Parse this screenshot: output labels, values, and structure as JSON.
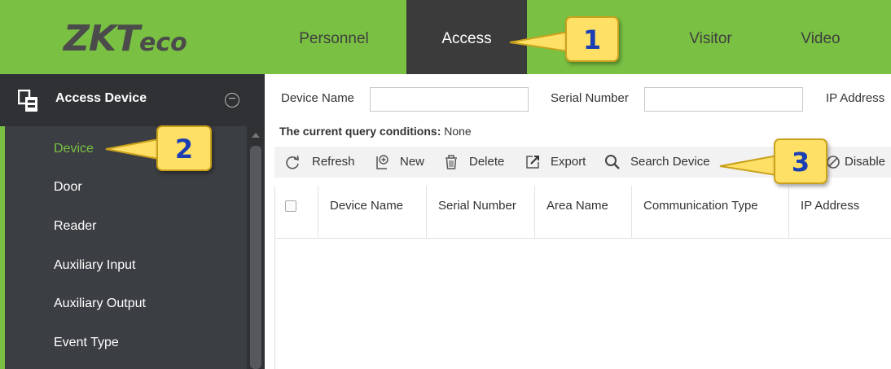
{
  "logo": {
    "main": "ZKT",
    "suffix": "eco"
  },
  "nav": {
    "tabs": [
      {
        "label": "Personnel",
        "active": false
      },
      {
        "label": "Access",
        "active": true
      },
      {
        "label": "Visitor",
        "active": false
      },
      {
        "label": "Video",
        "active": false
      }
    ]
  },
  "sidebar": {
    "header": "Access Device",
    "collapse_symbol": "−",
    "items": [
      {
        "label": "Device",
        "active": true
      },
      {
        "label": "Door",
        "active": false
      },
      {
        "label": "Reader",
        "active": false
      },
      {
        "label": "Auxiliary Input",
        "active": false
      },
      {
        "label": "Auxiliary Output",
        "active": false
      },
      {
        "label": "Event Type",
        "active": false
      }
    ]
  },
  "filters": {
    "device_name_label": "Device Name",
    "device_name_value": "",
    "serial_number_label": "Serial Number",
    "serial_number_value": "",
    "ip_address_label": "IP Address"
  },
  "query": {
    "label": "The current query conditions:",
    "value": "None"
  },
  "toolbar": {
    "refresh": "Refresh",
    "new": "New",
    "delete": "Delete",
    "export": "Export",
    "search_device": "Search Device",
    "disable": "Disable"
  },
  "table": {
    "columns": [
      "Device Name",
      "Serial Number",
      "Area Name",
      "Communication Type",
      "IP Address"
    ],
    "rows": []
  },
  "callouts": [
    "1",
    "2",
    "3"
  ],
  "colors": {
    "brand_green": "#7ac143",
    "nav_active": "#3b3b3b",
    "sidebar_bg": "#3b3e42",
    "callout_yellow": "#ffe066",
    "callout_text": "#1b3fb3"
  }
}
